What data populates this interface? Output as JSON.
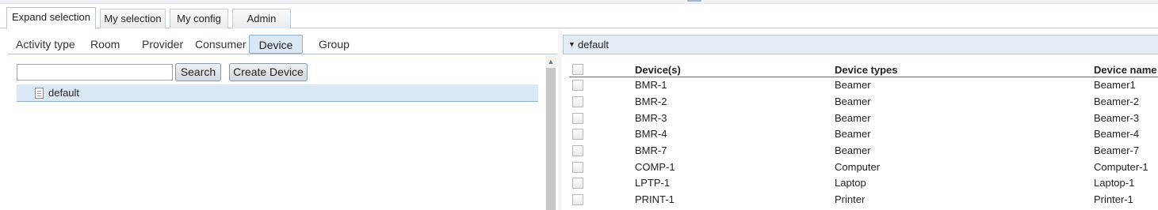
{
  "tabs": [
    {
      "label": "Expand selection",
      "active": true
    },
    {
      "label": "My selection",
      "active": false
    },
    {
      "label": "My config",
      "active": false
    },
    {
      "label": "Admin",
      "active": false
    }
  ],
  "subnav": [
    "Activity type",
    "Room",
    "Provider",
    "Consumer",
    "Device",
    "Group"
  ],
  "subnav_active": "Device",
  "search": {
    "value": "",
    "button": "Search"
  },
  "create_button": "Create Device",
  "tree": {
    "item": "default",
    "icon": "document-icon"
  },
  "panel": {
    "title": "default",
    "icon": "caret-down-icon"
  },
  "table": {
    "headers": [
      "Device(s)",
      "Device types",
      "Device name"
    ],
    "rows": [
      [
        "BMR-1",
        "Beamer",
        "Beamer1"
      ],
      [
        "BMR-2",
        "Beamer",
        "Beamer-2"
      ],
      [
        "BMR-3",
        "Beamer",
        "Beamer-3"
      ],
      [
        "BMR-4",
        "Beamer",
        "Beamer-4"
      ],
      [
        "BMR-7",
        "Beamer",
        "Beamer-7"
      ],
      [
        "COMP-1",
        "Computer",
        "Computer-1"
      ],
      [
        "LPTP-1",
        "Laptop",
        "Laptop-1"
      ],
      [
        "PRINT-1",
        "Printer",
        "Printer-1"
      ]
    ]
  },
  "colors": {
    "accent": "#dbe7f3",
    "selection": "#dbe8f5",
    "border": "#b9c6d2"
  }
}
